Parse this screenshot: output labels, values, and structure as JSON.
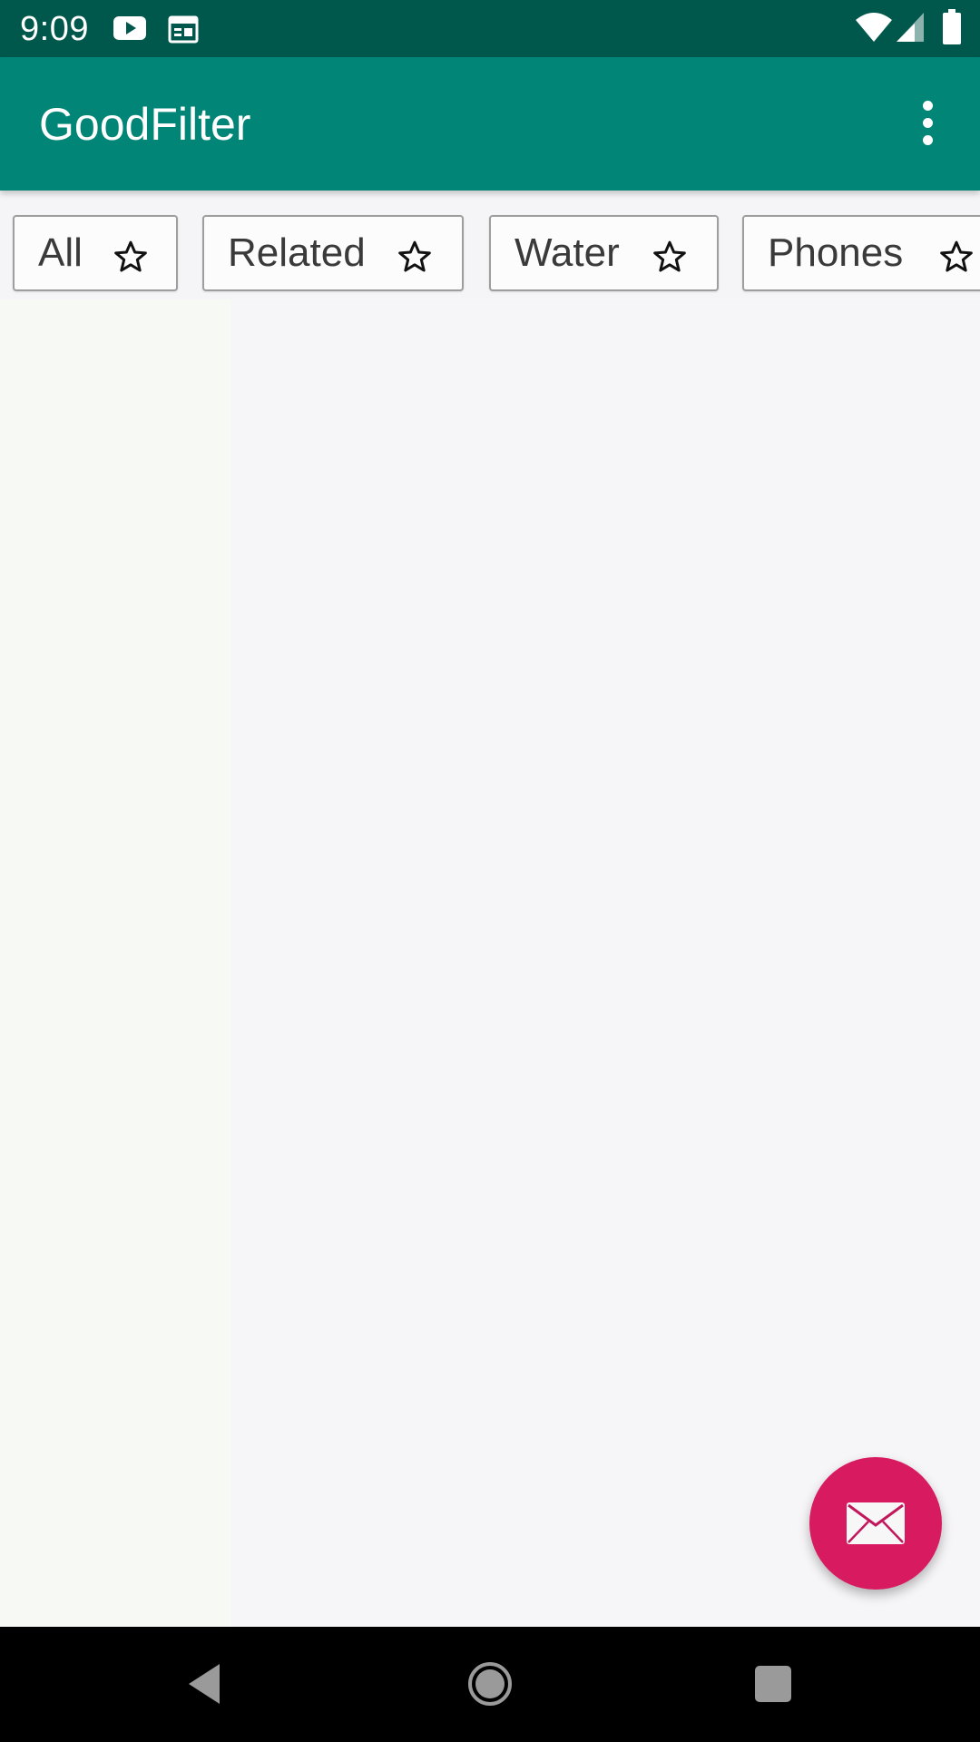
{
  "status_bar": {
    "time": "9:09",
    "icons": [
      "youtube-icon",
      "calendar-icon",
      "wifi-icon",
      "signal-icon",
      "battery-icon"
    ]
  },
  "app_bar": {
    "title": "GoodFilter",
    "menu_icon": "more-vert-icon"
  },
  "chips": [
    {
      "label": "All",
      "icon": "star-outline-icon"
    },
    {
      "label": "Related",
      "icon": "star-outline-icon"
    },
    {
      "label": "Water",
      "icon": "star-outline-icon"
    },
    {
      "label": "Phones",
      "icon": "star-outline-icon"
    }
  ],
  "fab": {
    "icon": "envelope-icon"
  },
  "nav_bar": {
    "icons": [
      "back-icon",
      "home-icon",
      "recents-icon"
    ]
  },
  "colors": {
    "status_bar": "#00574b",
    "app_bar": "#008577",
    "fab": "#d81b60",
    "chip_border": "#9e9e9e"
  }
}
